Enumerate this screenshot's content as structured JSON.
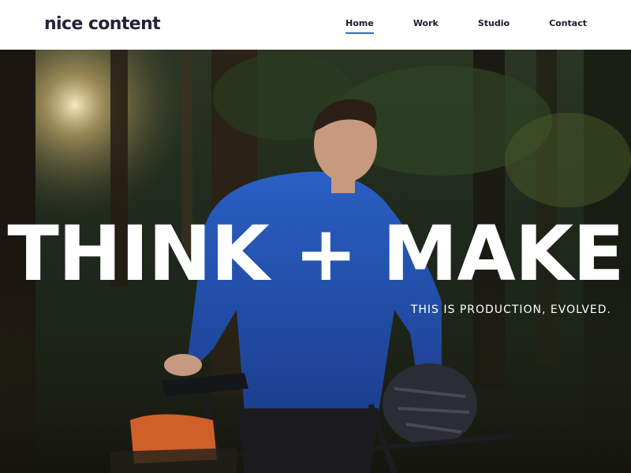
{
  "brand": {
    "name": "nice content",
    "dot_color": "#3a64d8"
  },
  "nav": {
    "items": [
      {
        "label": "Home",
        "active": true
      },
      {
        "label": "Work"
      },
      {
        "label": "Studio"
      },
      {
        "label": "Contact"
      }
    ],
    "accent": "#3a64d8"
  },
  "hero": {
    "headline": "THINK + MAKE",
    "tagline": "THIS IS PRODUCTION, EVOLVED.",
    "image": "forest-cyclist-photo"
  }
}
